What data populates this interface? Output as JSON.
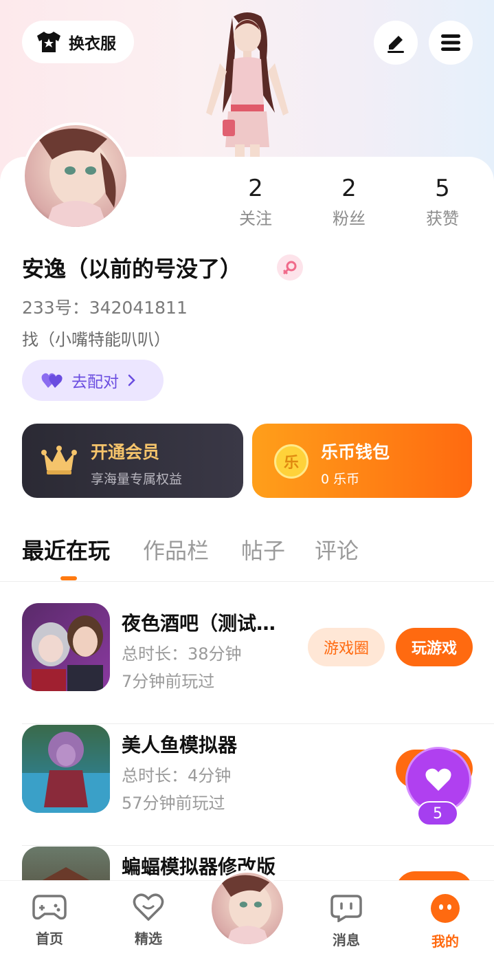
{
  "header": {
    "outfit_label": "换衣服",
    "icons": [
      "shirt-icon",
      "edit-icon",
      "menu-icon"
    ]
  },
  "stats": [
    {
      "num": "2",
      "label": "关注"
    },
    {
      "num": "2",
      "label": "粉丝"
    },
    {
      "num": "5",
      "label": "获赞"
    }
  ],
  "profile": {
    "username": "安逸（以前的号没了）",
    "uid": "233号：342041811",
    "bio": "找（小嘴特能叭叭）",
    "match_label": "去配对"
  },
  "vip": {
    "title": "开通会员",
    "subtitle": "享海量专属权益"
  },
  "wallet": {
    "title": "乐币钱包",
    "subtitle": "0 乐币",
    "coin_glyph": "乐"
  },
  "tabs": [
    "最近在玩",
    "作品栏",
    "帖子",
    "评论"
  ],
  "games": [
    {
      "title": "夜色酒吧（测试…",
      "duration": "总时长：38分钟",
      "last_played": "7分钟前玩过",
      "circle_label": "游戏圈",
      "play_label": "玩游戏"
    },
    {
      "title": "美人鱼模拟器",
      "duration": "总时长：4分钟",
      "last_played": "57分钟前玩过"
    },
    {
      "title": "蝙蝠模拟器修改版"
    }
  ],
  "like_float": {
    "count": "5"
  },
  "nav": [
    {
      "label": "首页"
    },
    {
      "label": "精选"
    },
    {
      "label": "消息"
    },
    {
      "label": "我的"
    }
  ],
  "colors": {
    "accent": "#ff6a10",
    "vip_gold": "#f5c46b",
    "match_purple": "#6a4de0",
    "like_purple": "#b040f0"
  }
}
